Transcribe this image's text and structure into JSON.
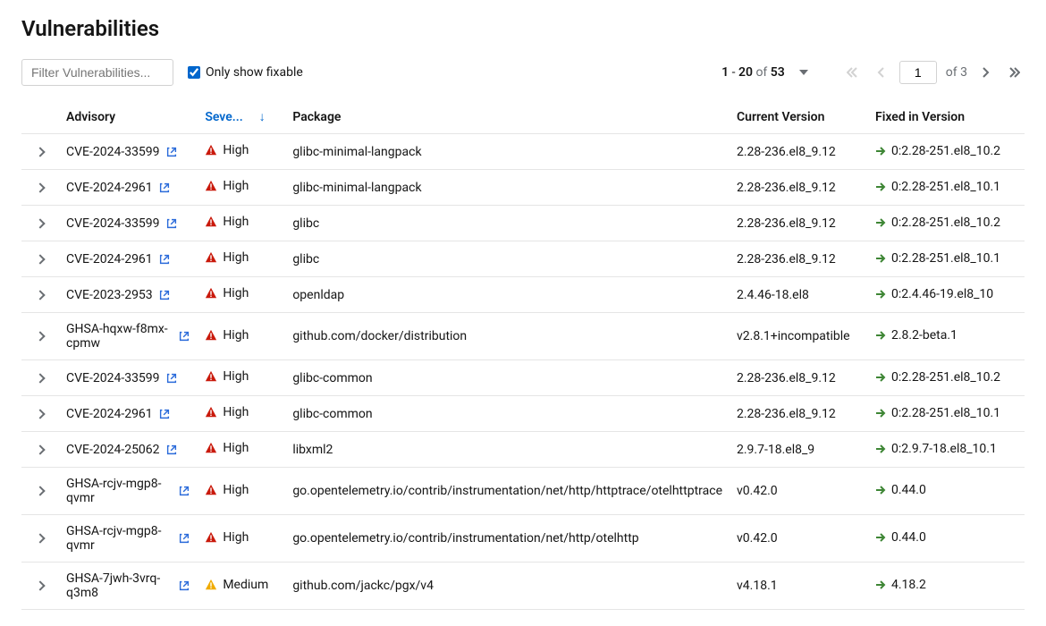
{
  "title": "Vulnerabilities",
  "filter": {
    "placeholder": "Filter Vulnerabilities..."
  },
  "checkbox": {
    "label": "Only show fixable",
    "checked": true
  },
  "pagination": {
    "range_start": "1",
    "range_end": "20",
    "total_items": "53",
    "page_input": "1",
    "total_pages": "3",
    "of": "of"
  },
  "columns": {
    "advisory": "Advisory",
    "severity": "Seve...",
    "package": "Package",
    "current": "Current Version",
    "fixed": "Fixed in Version"
  },
  "severity_colors": {
    "High": "#c9190b",
    "Medium": "#f0ab00"
  },
  "rows": [
    {
      "advisory": "CVE-2024-33599",
      "severity": "High",
      "package": "glibc-minimal-langpack",
      "current": "2.28-236.el8_9.12",
      "fixed": "0:2.28-251.el8_10.2"
    },
    {
      "advisory": "CVE-2024-2961",
      "severity": "High",
      "package": "glibc-minimal-langpack",
      "current": "2.28-236.el8_9.12",
      "fixed": "0:2.28-251.el8_10.1"
    },
    {
      "advisory": "CVE-2024-33599",
      "severity": "High",
      "package": "glibc",
      "current": "2.28-236.el8_9.12",
      "fixed": "0:2.28-251.el8_10.2"
    },
    {
      "advisory": "CVE-2024-2961",
      "severity": "High",
      "package": "glibc",
      "current": "2.28-236.el8_9.12",
      "fixed": "0:2.28-251.el8_10.1"
    },
    {
      "advisory": "CVE-2023-2953",
      "severity": "High",
      "package": "openldap",
      "current": "2.4.46-18.el8",
      "fixed": "0:2.4.46-19.el8_10"
    },
    {
      "advisory": "GHSA-hqxw-f8mx-cpmw",
      "severity": "High",
      "package": "github.com/docker/distribution",
      "current": "v2.8.1+incompatible",
      "fixed": "2.8.2-beta.1"
    },
    {
      "advisory": "CVE-2024-33599",
      "severity": "High",
      "package": "glibc-common",
      "current": "2.28-236.el8_9.12",
      "fixed": "0:2.28-251.el8_10.2"
    },
    {
      "advisory": "CVE-2024-2961",
      "severity": "High",
      "package": "glibc-common",
      "current": "2.28-236.el8_9.12",
      "fixed": "0:2.28-251.el8_10.1"
    },
    {
      "advisory": "CVE-2024-25062",
      "severity": "High",
      "package": "libxml2",
      "current": "2.9.7-18.el8_9",
      "fixed": "0:2.9.7-18.el8_10.1"
    },
    {
      "advisory": "GHSA-rcjv-mgp8-qvmr",
      "severity": "High",
      "package": "go.opentelemetry.io/contrib/instrumentation/net/http/httptrace/otelhttptrace",
      "current": "v0.42.0",
      "fixed": "0.44.0"
    },
    {
      "advisory": "GHSA-rcjv-mgp8-qvmr",
      "severity": "High",
      "package": "go.opentelemetry.io/contrib/instrumentation/net/http/otelhttp",
      "current": "v0.42.0",
      "fixed": "0.44.0"
    },
    {
      "advisory": "GHSA-7jwh-3vrq-q3m8",
      "severity": "Medium",
      "package": "github.com/jackc/pgx/v4",
      "current": "v4.18.1",
      "fixed": "4.18.2"
    }
  ]
}
